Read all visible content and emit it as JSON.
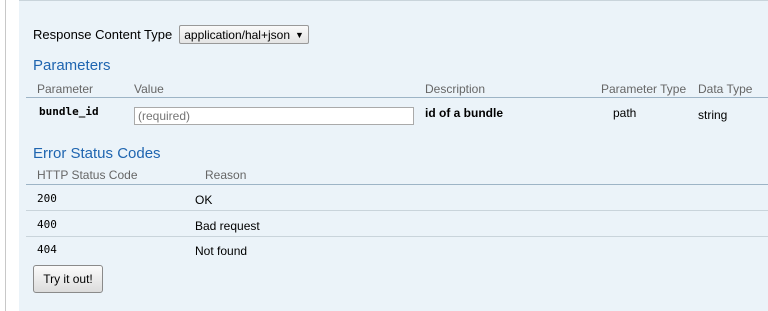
{
  "response_content_type": {
    "label": "Response Content Type",
    "selected": "application/hal+json"
  },
  "parameters": {
    "heading": "Parameters",
    "columns": [
      "Parameter",
      "Value",
      "Description",
      "Parameter Type",
      "Data Type"
    ],
    "rows": [
      {
        "name": "bundle_id",
        "value": "",
        "placeholder": "(required)",
        "description": "id of a bundle",
        "param_type": "path",
        "data_type": "string"
      }
    ]
  },
  "errors": {
    "heading": "Error Status Codes",
    "columns": [
      "HTTP Status Code",
      "Reason"
    ],
    "rows": [
      {
        "code": "200",
        "reason": "OK"
      },
      {
        "code": "400",
        "reason": "Bad request"
      },
      {
        "code": "404",
        "reason": "Not found"
      }
    ]
  },
  "try_button": {
    "label": "Try it out!"
  }
}
